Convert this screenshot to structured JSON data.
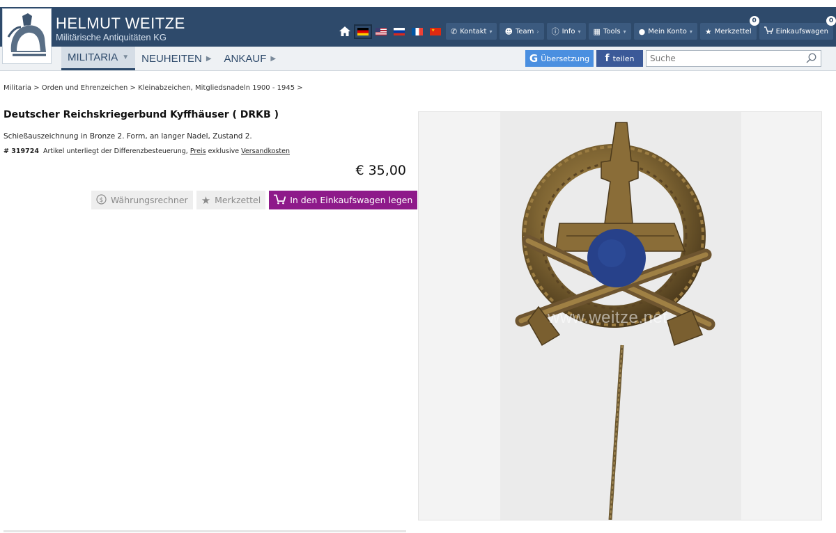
{
  "brand": {
    "name": "HELMUT WEITZE",
    "subtitle": "Militärische Antiquitäten KG"
  },
  "topnav": {
    "flags": [
      "de",
      "us",
      "ru",
      "fr",
      "cn"
    ],
    "kontakt": "Kontakt",
    "team": "Team",
    "info": "Info",
    "tools": "Tools",
    "konto": "Mein Konto",
    "merkzettel": "Merkzettel",
    "merkzettel_count": "0",
    "cart": "Einkaufswagen",
    "cart_count": "0"
  },
  "menu": {
    "items": [
      {
        "label": "MILITARIA",
        "active": true
      },
      {
        "label": "NEUHEITEN",
        "active": false
      },
      {
        "label": "ANKAUF",
        "active": false
      }
    ]
  },
  "translate": {
    "label": "Übersetzung"
  },
  "share": {
    "label": "teilen"
  },
  "search": {
    "placeholder": "Suche"
  },
  "breadcrumb": "Militaria > Orden und Ehrenzeichen > Kleinabzeichen, Mitgliedsnadeln 1900 - 1945 >",
  "product": {
    "title": "Deutscher Reichskriegerbund Kyffhäuser ( DRKB )",
    "description": "Schießauszeichnung in Bronze 2. Form, an langer Nadel, Zustand 2.",
    "item_no": "# 319724",
    "tax_note": "Artikel unterliegt der Differenzbesteuerung,",
    "price_link": "Preis",
    "exclusive": "exklusive",
    "shipping_link": "Versandkosten",
    "price": "€ 35,00"
  },
  "actions": {
    "currency": "Währungsrechner",
    "merkzettel": "Merkzettel",
    "cart": "In den Einkaufswagen legen"
  },
  "image": {
    "watermark": "www.weitze.net"
  },
  "colors": {
    "header": "#2e4a6b",
    "accent_purple": "#8e1a8a",
    "translate_blue": "#4a8fe0",
    "facebook_blue": "#3b5998"
  }
}
